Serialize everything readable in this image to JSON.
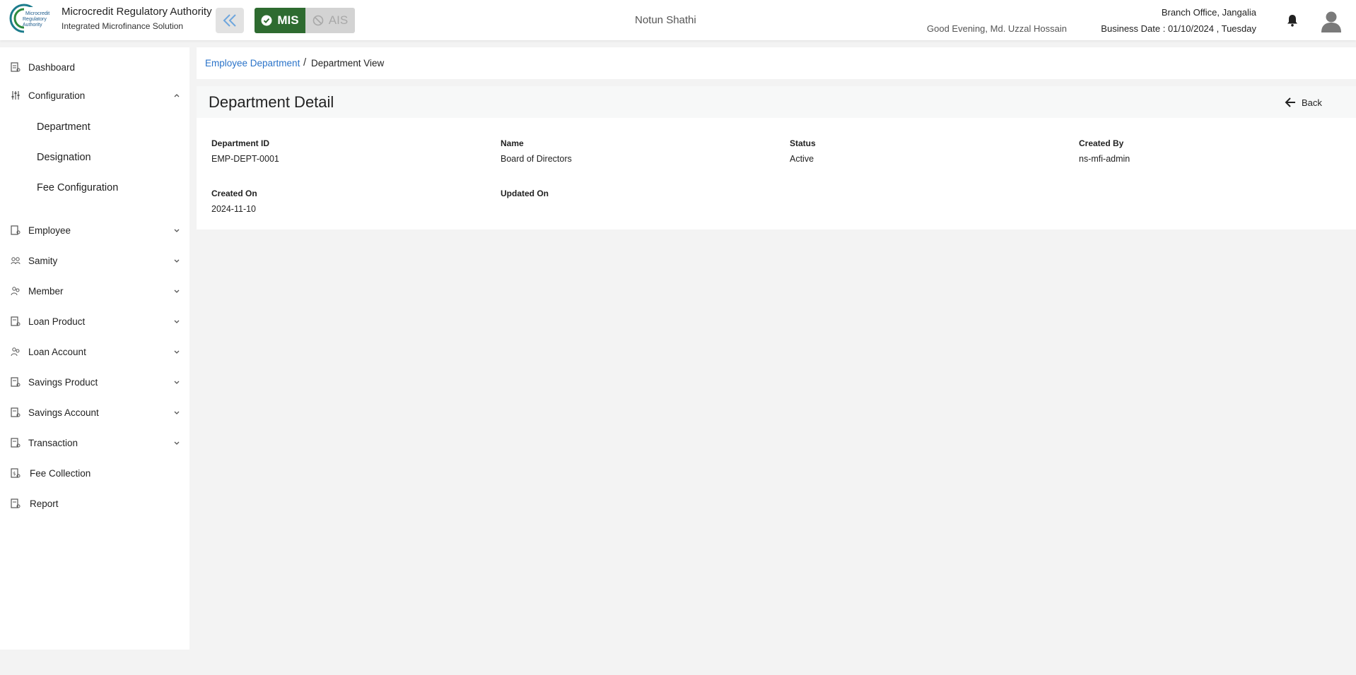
{
  "header": {
    "org_name": "Microcredit Regulatory Authority",
    "org_subtitle": "Integrated Microfinance Solution",
    "logo_text": [
      "Microcredit",
      "Regulatory",
      "Authority"
    ],
    "mode_mis": "MIS",
    "mode_ais": "AIS",
    "center_name": "Notun Shathi",
    "greeting": "Good Evening, Md. Uzzal Hossain",
    "branch_office": "Branch Office, Jangalia",
    "business_date": "Business Date : 01/10/2024 , Tuesday",
    "accent_color": "#2e6b30"
  },
  "sidebar": {
    "items": [
      {
        "label": "Dashboard",
        "icon": "dashboard-icon"
      },
      {
        "label": "Configuration",
        "icon": "sliders-icon",
        "expanded": true
      },
      {
        "label": "Employee",
        "icon": "employee-icon"
      },
      {
        "label": "Samity",
        "icon": "group-icon"
      },
      {
        "label": "Member",
        "icon": "members-icon"
      },
      {
        "label": "Loan Product",
        "icon": "document-icon"
      },
      {
        "label": "Loan Account",
        "icon": "members-icon"
      },
      {
        "label": "Savings Product",
        "icon": "document-icon"
      },
      {
        "label": "Savings Account",
        "icon": "document-icon"
      },
      {
        "label": "Transaction",
        "icon": "document-icon"
      },
      {
        "label": "Fee Collection",
        "icon": "fee-icon"
      },
      {
        "label": "Report",
        "icon": "document-icon"
      }
    ],
    "config_sub": [
      "Department",
      "Designation",
      "Fee Configuration"
    ]
  },
  "breadcrumb": {
    "parent": "Employee Department",
    "separator": "/",
    "current": "Department View"
  },
  "detail": {
    "title": "Department Detail",
    "back_label": "Back",
    "fields": [
      {
        "label": "Department ID",
        "value": "EMP-DEPT-0001"
      },
      {
        "label": "Name",
        "value": "Board of Directors"
      },
      {
        "label": "Status",
        "value": "Active"
      },
      {
        "label": "Created By",
        "value": "ns-mfi-admin"
      },
      {
        "label": "Created On",
        "value": "2024-11-10"
      },
      {
        "label": "Updated On",
        "value": ""
      }
    ]
  }
}
